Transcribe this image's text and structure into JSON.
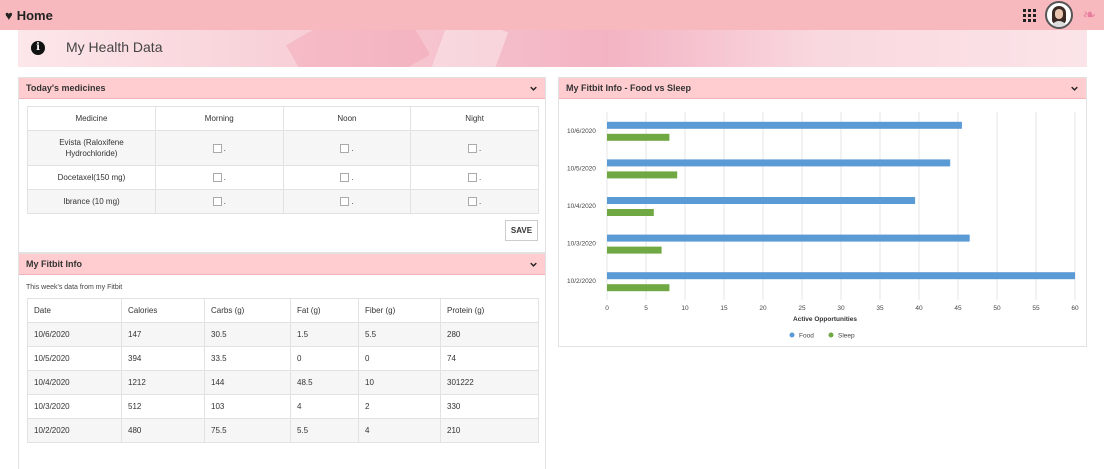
{
  "topbar": {
    "home_label": "Home"
  },
  "banner": {
    "title": "My Health Data"
  },
  "medicines": {
    "header": "Today's medicines",
    "columns": [
      "Medicine",
      "Morning",
      "Noon",
      "Night"
    ],
    "rows": [
      {
        "name": "Evista (Raloxifene Hydrochloride)"
      },
      {
        "name": "Docetaxel(150 mg)"
      },
      {
        "name": "Ibrance (10 mg)"
      }
    ],
    "checkbox_suffix": ".",
    "save_label": "SAVE"
  },
  "fitbit": {
    "header": "My Fitbit Info",
    "subtitle": "This week's data from my Fitbit",
    "columns": [
      "Date",
      "Calories",
      "Carbs (g)",
      "Fat (g)",
      "Fiber (g)",
      "Protein (g)"
    ],
    "rows": [
      [
        "10/6/2020",
        "147",
        "30.5",
        "1.5",
        "5.5",
        "280"
      ],
      [
        "10/5/2020",
        "394",
        "33.5",
        "0",
        "0",
        "74"
      ],
      [
        "10/4/2020",
        "1212",
        "144",
        "48.5",
        "10",
        "301222"
      ],
      [
        "10/3/2020",
        "512",
        "103",
        "4",
        "2",
        "330"
      ],
      [
        "10/2/2020",
        "480",
        "75.5",
        "5.5",
        "4",
        "210"
      ]
    ]
  },
  "chart_panel": {
    "header": "My Fitbit Info - Food vs Sleep"
  },
  "colors": {
    "food": "#5b9bd5",
    "sleep": "#70a844",
    "header_bg": "#ffcdd0",
    "topbar_bg": "#f8b9be"
  },
  "chart_data": {
    "type": "bar",
    "orientation": "horizontal",
    "categories": [
      "10/6/2020",
      "10/5/2020",
      "10/4/2020",
      "10/3/2020",
      "10/2/2020"
    ],
    "series": [
      {
        "name": "Food",
        "values": [
          45.5,
          44,
          39.5,
          46.5,
          60
        ]
      },
      {
        "name": "Sleep",
        "values": [
          8,
          9,
          6,
          7,
          8
        ]
      }
    ],
    "xlabel": "Active Opportunities",
    "xlim": [
      0,
      60
    ],
    "xticks": [
      0,
      5,
      10,
      15,
      20,
      25,
      30,
      35,
      40,
      45,
      50,
      55,
      60
    ],
    "grid": true,
    "legend": "bottom"
  }
}
